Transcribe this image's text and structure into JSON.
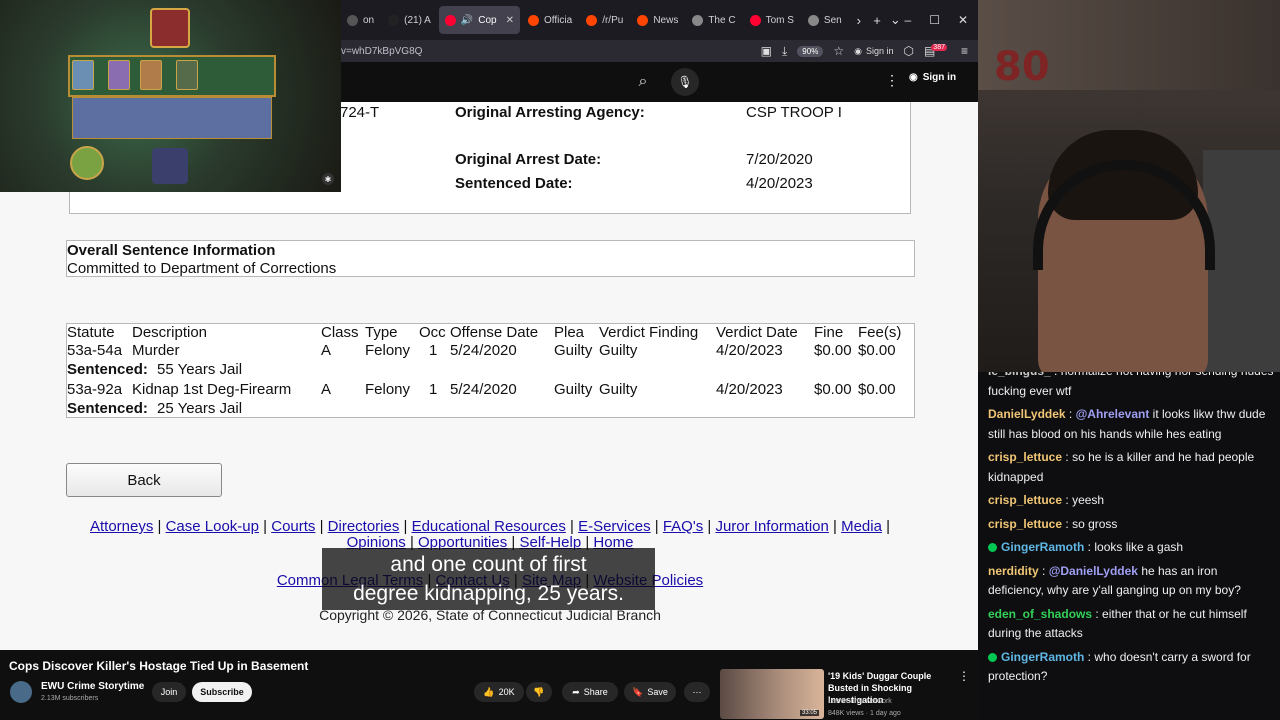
{
  "browser": {
    "tabs": [
      {
        "label": "on",
        "color": "#555"
      },
      {
        "label": "(21) A",
        "color": "#222",
        "icon": "X"
      },
      {
        "label": "Cop",
        "color": "#ff0033",
        "active": true
      },
      {
        "label": "Officia",
        "color": "#ff4500"
      },
      {
        "label": "/r/Pu",
        "color": "#ff4500"
      },
      {
        "label": "News",
        "color": "#ff4500"
      },
      {
        "label": "The C",
        "color": "#888",
        "icon": "W"
      },
      {
        "label": "Tom S",
        "color": "#ff0033"
      },
      {
        "label": "Sen",
        "color": "#888"
      }
    ],
    "url": "v=whD7kBpVG8Q",
    "zoom": "90%",
    "signin": "Sign in",
    "notif_count": "387"
  },
  "youtube_header": {
    "signin": "Sign in"
  },
  "document": {
    "case_fragment": "724-T",
    "arresting_agency_label": "Original Arresting Agency:",
    "arresting_agency_value": "CSP TROOP I",
    "arrest_date_label": "Original Arrest Date:",
    "arrest_date_value": "7/20/2020",
    "sentenced_date_label": "Sentenced Date:",
    "sentenced_date_value": "4/20/2023",
    "overall_title": "Overall Sentence Information",
    "overall_value": "Committed to Department of Corrections",
    "headers": [
      "Statute",
      "Description",
      "Class",
      "Type",
      "Occ",
      "Offense Date",
      "Plea",
      "Verdict Finding",
      "Verdict Date",
      "Fine",
      "Fee(s)"
    ],
    "charges": [
      {
        "statute": "53a-54a",
        "description": "Murder",
        "class": "A",
        "type": "Felony",
        "occ": "1",
        "offense_date": "5/24/2020",
        "plea": "Guilty",
        "verdict": "Guilty",
        "verdict_date": "4/20/2023",
        "fine": "$0.00",
        "fees": "$0.00",
        "sentence_label": "Sentenced:",
        "sentence": "55 Years Jail"
      },
      {
        "statute": "53a-92a",
        "description": "Kidnap 1st Deg-Firearm",
        "class": "A",
        "type": "Felony",
        "occ": "1",
        "offense_date": "5/24/2020",
        "plea": "Guilty",
        "verdict": "Guilty",
        "verdict_date": "4/20/2023",
        "fine": "$0.00",
        "fees": "$0.00",
        "sentence_label": "Sentenced:",
        "sentence": "25 Years Jail"
      }
    ],
    "back_button": "Back",
    "links_row1": [
      "Attorneys",
      "Case Look-up",
      "Courts",
      "Directories",
      "Educational Resources",
      "E-Services",
      "FAQ's",
      "Juror Information",
      "Media"
    ],
    "links_row2": [
      "Opinions",
      "Opportunities",
      "Self-Help",
      "Home"
    ],
    "links_row3": [
      "Common Legal Terms",
      "Contact Us",
      "Site Map",
      "Website Policies"
    ],
    "copyright": "Copyright © 2026, State of Connecticut Judicial Branch"
  },
  "caption": {
    "line1": "and one count of first",
    "line2": "degree kidnapping, 25 years."
  },
  "video_info": {
    "title": "Cops Discover Killer's Hostage Tied Up in Basement",
    "channel": "EWU Crime Storytime",
    "subscribers": "2.13M subscribers",
    "join": "Join",
    "subscribe": "Subscribe",
    "likes": "20K",
    "share": "Share",
    "save": "Save"
  },
  "recommended": {
    "title": "'19 Kids' Duggar Couple Busted in Shocking Investigation",
    "channel": "Law&Crime Network",
    "meta": "848K views · 1 day ago",
    "duration": "33:05"
  },
  "chat": [
    {
      "user": "le_bingus_",
      "color": "#c9c9c9",
      "text": "normalize not having hor sending nudes fucking ever wtf",
      "cut": true
    },
    {
      "user": "DanielLyddek",
      "color": "#f0c674",
      "mention": "@Ahrelevant",
      "text": "it looks likw thw dude still has blood on his hands while hes eating"
    },
    {
      "user": "crisp_lettuce",
      "color": "#f0c674",
      "text": "so he is a killer and he had people kidnapped"
    },
    {
      "user": "crisp_lettuce",
      "color": "#f0c674",
      "text": "yeesh"
    },
    {
      "user": "crisp_lettuce",
      "color": "#f0c674",
      "text": "so gross"
    },
    {
      "user": "GingerRamoth",
      "color": "#5fb7e5",
      "badge": true,
      "text": "looks like a gash"
    },
    {
      "user": "nerdidity",
      "color": "#f0c674",
      "mention": "@DanielLyddek",
      "text": "he has an iron deficiency, why are y'all ganging up on my boy?"
    },
    {
      "user": "eden_of_shadows",
      "color": "#34d058",
      "text": "either that or he cut himself during the attacks"
    },
    {
      "user": "GingerRamoth",
      "color": "#5fb7e5",
      "badge": true,
      "text": "who doesn't carry a sword for protection?"
    }
  ]
}
